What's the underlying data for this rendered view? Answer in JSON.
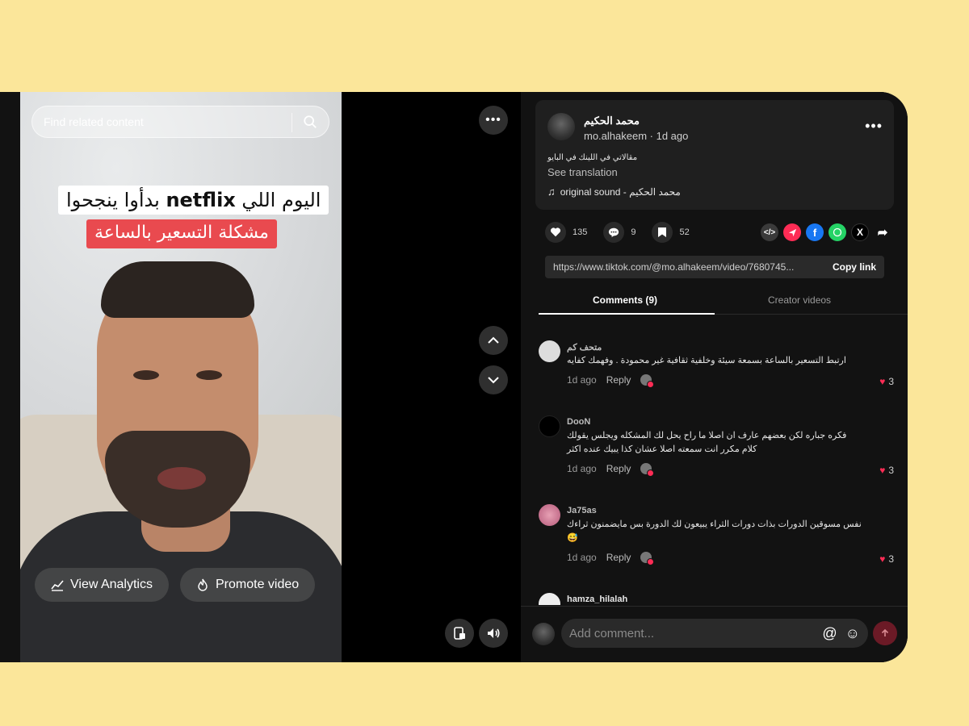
{
  "video": {
    "search_placeholder": "Find related content",
    "caption_line1_prefix": "اليوم اللي ",
    "caption_line1_brand": "netflix",
    "caption_line1_suffix": " بدأوا ينجحوا",
    "caption_line2": "مشكلة التسعير بالساعة",
    "view_analytics_label": "View Analytics",
    "promote_label": "Promote video"
  },
  "post": {
    "author_name": "محمد الحكيم",
    "author_handle": "mo.alhakeem · 1d ago",
    "description": "مقالاتي في اللينك في البايو",
    "see_translation": "See translation",
    "sound": "original sound - محمد الحكيم",
    "likes": "135",
    "comments": "9",
    "saves": "52",
    "link_url": "https://www.tiktok.com/@mo.alhakeem/video/7680745...",
    "copy_link_label": "Copy link"
  },
  "tabs": [
    {
      "label": "Comments (9)"
    },
    {
      "label": "Creator videos"
    }
  ],
  "comments": [
    {
      "user": "متحف كم",
      "text": "ارتبط التسعير بالساعة بسمعة سيئة وخلفية ثقافية غير محمودة . وفهمك كفايه",
      "time": "1d ago",
      "reply": "Reply",
      "likes": "3"
    },
    {
      "user": "DooN",
      "text": "فكره جباره لكن بعضهم عارف ان اصلا ما راح يحل لك المشكله ويجلس يقولك كلام مكرر انت سمعته اصلا عشان كذا يبيك عنده اكثر",
      "time": "1d ago",
      "reply": "Reply",
      "likes": "3"
    },
    {
      "user": "Ja75as",
      "text": "نفس مسوقين الدورات بذات دورات الثراء يبيعون لك الدورة بس مايضمنون ثراءك 😅",
      "time": "1d ago",
      "reply": "Reply",
      "likes": "3"
    },
    {
      "user": "hamza_hilalah",
      "text": "",
      "time": "",
      "reply": "",
      "likes": ""
    }
  ],
  "composer": {
    "placeholder": "Add comment...",
    "at_symbol": "@",
    "emoji_symbol": "☺"
  },
  "colors": {
    "accent_red": "#fe2c55",
    "caption_red": "#e94a4f",
    "background": "#fbe69a"
  }
}
